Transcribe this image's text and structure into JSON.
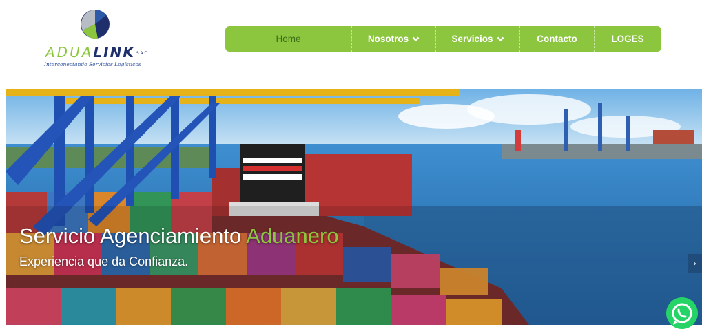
{
  "logo": {
    "part1": "ADUA",
    "part2": "LINK",
    "suffix": "S.A.C",
    "tagline": "Interconectando Servicios Logísticos"
  },
  "nav": {
    "items": [
      {
        "label": "Home",
        "active": true
      },
      {
        "label": "Nosotros",
        "dropdown": true
      },
      {
        "label": "Servicios",
        "dropdown": true
      },
      {
        "label": "Contacto"
      },
      {
        "label": "LOGES"
      }
    ]
  },
  "hero": {
    "title_main": "Servicio Agenciamiento",
    "title_accent": "Aduanero",
    "subtitle": "Experiencia que da Confianza.",
    "next_arrow": "›"
  },
  "colors": {
    "brand_green": "#8cc63f",
    "brand_navy": "#1e2f6b",
    "whatsapp": "#25d366"
  },
  "icons": {
    "chevron": "chevron-down-icon",
    "whatsapp": "whatsapp-icon"
  }
}
